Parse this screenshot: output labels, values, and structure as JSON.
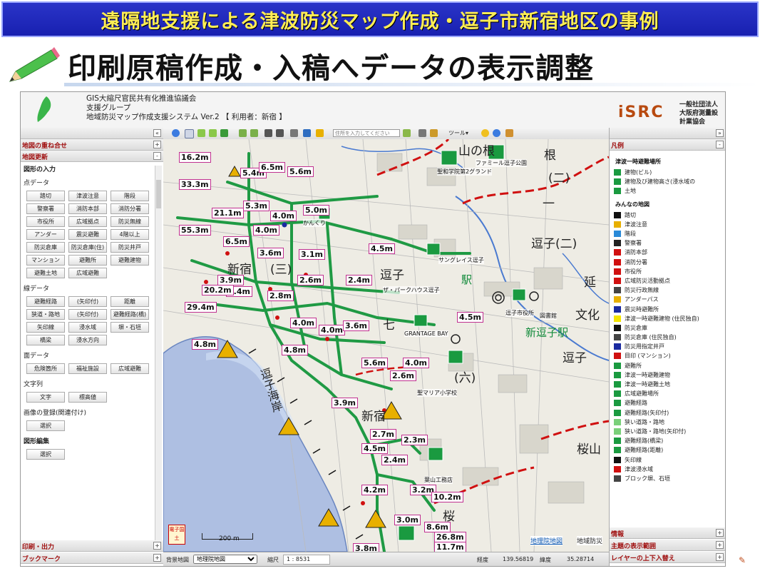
{
  "banner": {
    "text": "遠隔地支援による津波防災マップ作成・逗子市新宿地区の事例"
  },
  "slide_title": "印刷原稿作成・入稿へデータの表示調整",
  "app": {
    "header": {
      "line1": "GIS大縮尺官民共有化推進協議会",
      "line2": "支援グループ",
      "line3": "地域防災マップ作成支援システム Ver.2 【 利用者：新宿 】",
      "right_logo": "iSRC",
      "right_line1": "一般社団法人",
      "right_line2": "大阪府測量設計業協会"
    },
    "left_panel": {
      "bars_top": [
        "地図の重ね合せ",
        "地図更新"
      ],
      "section_figure": "図形の入力",
      "section_point": "点データ",
      "point_buttons": [
        "踏切",
        "津波注意",
        "階段",
        "警察署",
        "消防本部",
        "消防分署",
        "市役所",
        "広域拠点",
        "防災無線",
        "アンダー",
        "震災避難",
        "4階以上",
        "防災倉庫",
        "防災倉庫(住)",
        "防災井戸",
        "マンション",
        "避難所",
        "避難建物",
        "避難土地",
        "広域避難"
      ],
      "section_line": "線データ",
      "line_buttons": [
        "避難経路",
        "(矢印付)",
        "距離",
        "狭道・路地",
        "(矢印付)",
        "避難経路(橋)",
        "矢印線",
        "浸水域",
        "塀・石垣",
        "橋梁",
        "浸水方向"
      ],
      "section_area": "面データ",
      "area_buttons": [
        "危険箇所",
        "福祉施設",
        "広域避難"
      ],
      "section_text": "文字列",
      "text_buttons": [
        "文字",
        "標高値"
      ],
      "section_image": "画像の登録(関連付け)",
      "image_button": "選択",
      "section_edit": "図形編集",
      "edit_button": "選択",
      "bars_bottom": [
        "印刷・出力",
        "ブックマーク"
      ]
    },
    "toolbar": {
      "search_placeholder": "住所を入力してください",
      "tool_menu": "ツール▾"
    },
    "map": {
      "height_labels": [
        "16.2m",
        "5.4m",
        "5.6m",
        "33.3m",
        "6.5m",
        "5.3m",
        "4.0m",
        "21.1m",
        "5.0m",
        "55.3m",
        "4.0m",
        "6.5m",
        "3.6m",
        "3.1m",
        "4.5m",
        "3.9m",
        "2.6m",
        "2.4m",
        "6.4m",
        "2.8m",
        "20.2m",
        "29.4m",
        "4.0m",
        "4.0m",
        "3.6m",
        "4.8m",
        "4.8m",
        "5.6m",
        "4.0m",
        "4.5m",
        "2.6m",
        "3.9m",
        "2.7m",
        "2.3m",
        "4.5m",
        "2.4m",
        "4.2m",
        "3.2m",
        "10.2m",
        "3.0m",
        "8.6m",
        "26.8m",
        "11.7m",
        "3.8m"
      ],
      "places": [
        "根",
        "(二)",
        "山の根",
        "逗子(二)",
        "新宿",
        "(三)",
        "逗子",
        "七",
        "延",
        "文化",
        "新逗子駅",
        "逗子",
        "(六)",
        "新宿",
        "桜山",
        "桜",
        "一",
        "駅"
      ],
      "coast_label": "逗子海岸",
      "facility_labels": [
        "聖和学院第2グランド",
        "ファミール逗子公園",
        "かんくり",
        "サングレイス逗子",
        "ザ・パークハウス逗子",
        "逗子市役所",
        "GRANTAGE BAY",
        "図書館",
        "聖マリア小学校",
        "葉山工務店"
      ],
      "scale_label": "200 m",
      "credit_link": "地理院地図",
      "credit_text": "地域防災"
    },
    "status_bar": {
      "bg_map_label": "背景地図",
      "bg_map_value": "地理院地図",
      "scale_label": "縮尺",
      "scale_value": "1 : 8531",
      "lon_label": "経度",
      "lon_value": "139.56819",
      "lat_label": "緯度",
      "lat_value": "35.28714"
    },
    "right_panel": {
      "title": "凡例",
      "group1": "津波一時避難場所",
      "group1_items": [
        "建物(ビル)",
        "建物及び建物高さ(浸水域の",
        "土地"
      ],
      "group2": "みんなの地図",
      "legend_items": [
        {
          "label": "踏切",
          "color": "#111111"
        },
        {
          "label": "津波注意",
          "color": "#e8b000"
        },
        {
          "label": "階段",
          "color": "#2a8ad8"
        },
        {
          "label": "警察署",
          "color": "#222222"
        },
        {
          "label": "消防本部",
          "color": "#d01010"
        },
        {
          "label": "消防分署",
          "color": "#d01010"
        },
        {
          "label": "市役所",
          "color": "#d01010"
        },
        {
          "label": "広域防災活動拠点",
          "color": "#d01010"
        },
        {
          "label": "防災行政無線",
          "color": "#444444"
        },
        {
          "label": "アンダーパス",
          "color": "#e8b000"
        },
        {
          "label": "震災時避難所",
          "color": "#1a2aa0"
        },
        {
          "label": "津波一時避難建物 (住民独自)",
          "color": "#f4e400"
        },
        {
          "label": "防災倉庫",
          "color": "#111111"
        },
        {
          "label": "防災倉庫 (住民独自)",
          "color": "#444444"
        },
        {
          "label": "防災用指定井戸",
          "color": "#1a2aa0"
        },
        {
          "label": "目印 (マンション)",
          "color": "#d01010"
        },
        {
          "label": "避難所",
          "color": "#1a9a40"
        },
        {
          "label": "津波一時避難建物",
          "color": "#1a9a40"
        },
        {
          "label": "津波一時避難土地",
          "color": "#1a9a40"
        },
        {
          "label": "広域避難場所",
          "color": "#1a9a40"
        },
        {
          "label": "避難経路",
          "color": "#1a9a40"
        },
        {
          "label": "避難経路(矢印付)",
          "color": "#1a9a40"
        },
        {
          "label": "狭い道路・路地",
          "color": "#7ad07a"
        },
        {
          "label": "狭い道路・路地(矢印付)",
          "color": "#7ad07a"
        },
        {
          "label": "避難経路(橋梁)",
          "color": "#1a9a40"
        },
        {
          "label": "避難経路(距離)",
          "color": "#1a9a40"
        },
        {
          "label": "矢印線",
          "color": "#111111"
        },
        {
          "label": "津波浸水域",
          "color": "#d01010"
        },
        {
          "label": "ブロック塀、石垣",
          "color": "#444444"
        }
      ],
      "bottom_bars": [
        "情報",
        "主題の表示範囲",
        "レイヤーの上下入替え"
      ]
    },
    "sticker_text": "電子国土"
  }
}
